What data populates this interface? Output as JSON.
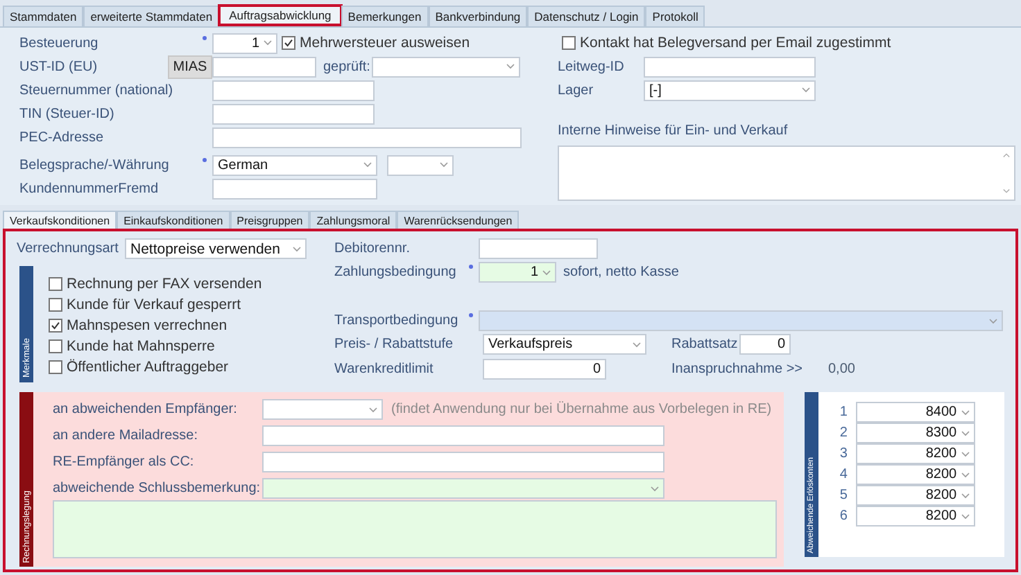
{
  "top_tabs": [
    {
      "label": "Stammdaten",
      "selected": false
    },
    {
      "label": "erweiterte Stammdaten",
      "selected": false
    },
    {
      "label": "Auftragsabwicklung",
      "selected": true
    },
    {
      "label": "Bemerkungen",
      "selected": false
    },
    {
      "label": "Bankverbindung",
      "selected": false
    },
    {
      "label": "Datenschutz / Login",
      "selected": false
    },
    {
      "label": "Protokoll",
      "selected": false
    }
  ],
  "upper": {
    "besteuerung": {
      "label": "Besteuerung",
      "required": true,
      "value": "1"
    },
    "mwst_checkbox": {
      "label": "Mehrwersteuer ausweisen",
      "checked": true
    },
    "ust_id": {
      "label": "UST-ID (EU)",
      "button": "MIAS",
      "checked_label": "geprüft:"
    },
    "steuernummer": {
      "label": "Steuernummer (national)"
    },
    "tin": {
      "label": "TIN (Steuer-ID)"
    },
    "pec": {
      "label": "PEC-Adresse"
    },
    "belegsprache": {
      "label": "Belegsprache/-Währung",
      "required": true,
      "value": "German"
    },
    "kundennummer_fremd": {
      "label": "KundennummerFremd"
    },
    "email_consent": {
      "label": "Kontakt hat Belegversand per Email zugestimmt",
      "checked": false
    },
    "leitweg_id": {
      "label": "Leitweg-ID"
    },
    "lager": {
      "label": "Lager",
      "value": "[-]"
    },
    "interne_hinweise": {
      "label": "Interne Hinweise für Ein- und Verkauf"
    }
  },
  "sub_tabs": [
    {
      "label": "Verkaufskonditionen",
      "selected": true
    },
    {
      "label": "Einkaufskonditionen",
      "selected": false
    },
    {
      "label": "Preisgruppen",
      "selected": false
    },
    {
      "label": "Zahlungsmoral",
      "selected": false
    },
    {
      "label": "Warenrücksendungen",
      "selected": false
    }
  ],
  "verkauf": {
    "verrechnungsart": {
      "label": "Verrechnungsart",
      "value": "Nettopreise verwenden"
    },
    "merkmale": {
      "title": "Merkmale",
      "options": [
        {
          "label": "Rechnung per FAX versenden",
          "checked": false
        },
        {
          "label": "Kunde für Verkauf gesperrt",
          "checked": false
        },
        {
          "label": "Mahnspesen verrechnen",
          "checked": true
        },
        {
          "label": "Kunde hat Mahnsperre",
          "checked": false
        },
        {
          "label": "Öffentlicher Auftraggeber",
          "checked": false
        }
      ]
    },
    "debitorennr": {
      "label": "Debitorennr."
    },
    "zahlungsbedingung": {
      "label": "Zahlungsbedingung",
      "required": true,
      "value": "1",
      "description": "sofort, netto Kasse"
    },
    "transportbedingung": {
      "label": "Transportbedingung",
      "required": true
    },
    "preisstufe": {
      "label": "Preis- / Rabattstufe",
      "value": "Verkaufspreis"
    },
    "rabattsatz": {
      "label": "Rabattsatz",
      "value": "0"
    },
    "warenkreditlimit": {
      "label": "Warenkreditlimit",
      "value": "0"
    },
    "inanspruchnahme": {
      "label": "Inanspruchnahme >>",
      "value": "0,00"
    }
  },
  "rechnungslegung": {
    "title": "Rechnungslegung",
    "empfaenger": {
      "label": "an abweichenden Empfänger:",
      "note": "(findet Anwendung nur bei Übernahme aus Vorbelegen in RE)"
    },
    "mailadresse": {
      "label": "an andere Mailadresse:"
    },
    "cc": {
      "label": "RE-Empfänger als CC:"
    },
    "schlussbemerkung": {
      "label": "abweichende Schlussbemerkung:"
    }
  },
  "erloeskonten": {
    "title": "Abweichende Erlöskonten",
    "rows": [
      {
        "index": "1",
        "value": "8400"
      },
      {
        "index": "2",
        "value": "8300"
      },
      {
        "index": "3",
        "value": "8200"
      },
      {
        "index": "4",
        "value": "8200"
      },
      {
        "index": "5",
        "value": "8200"
      },
      {
        "index": "6",
        "value": "8200"
      }
    ]
  }
}
